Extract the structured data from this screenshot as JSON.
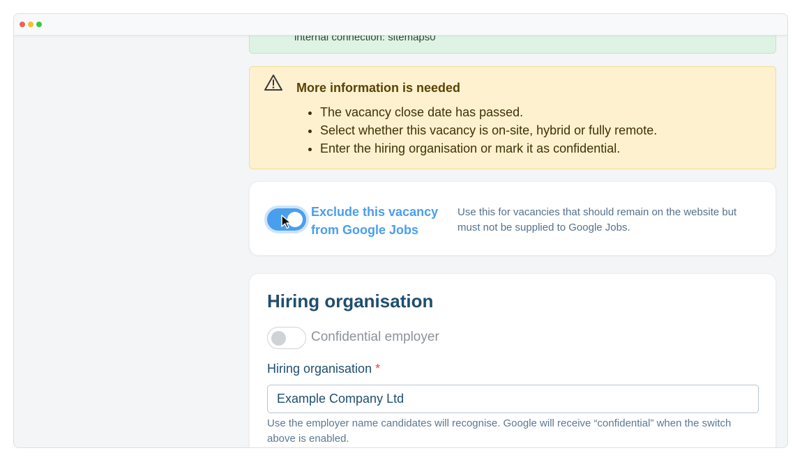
{
  "window": {
    "controls": [
      "close",
      "minimize",
      "maximize"
    ]
  },
  "success_alert": {
    "text": "internal connection: sitemaps0"
  },
  "warning_alert": {
    "icon": "warning-triangle-icon",
    "title": "More information is needed",
    "items": [
      "The vacancy close date has passed.",
      "Select whether this vacancy is on-site, hybrid or fully remote.",
      "Enter the hiring organisation or mark it as confidential."
    ]
  },
  "exclude": {
    "toggle_on": true,
    "label_line1": "Exclude this vacancy",
    "label_line2": "from Google Jobs",
    "help": "Use this for vacancies that should remain on the website but must not be supplied to Google Jobs."
  },
  "hiring": {
    "title": "Hiring organisation",
    "confidential_label": "Confidential employer",
    "confidential_on": false,
    "field_label": "Hiring organisation",
    "required_marker": "*",
    "field_value": "Example Company Ltd",
    "field_help": "Use the employer name candidates will recognise. Google will receive “confidential” when the switch above is enabled."
  },
  "colors": {
    "accent": "#4a9eee",
    "heading": "#1f4e6e",
    "warning_bg": "#fdf1cf",
    "success_bg": "#dff3e4",
    "required": "#e04848"
  }
}
